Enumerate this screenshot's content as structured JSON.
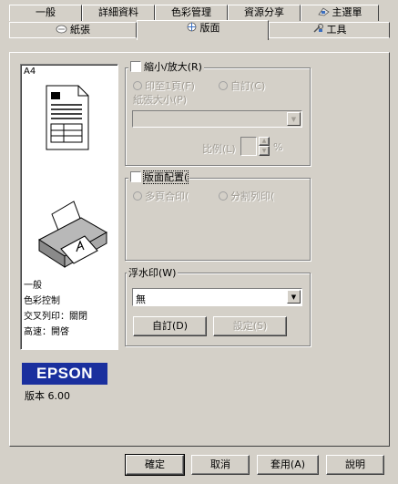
{
  "tabs_row1": [
    {
      "label": "一般"
    },
    {
      "label": "詳細資料"
    },
    {
      "label": "色彩管理"
    },
    {
      "label": "資源分享"
    },
    {
      "label": "主選單"
    }
  ],
  "tabs_row2": [
    {
      "label": "紙張"
    },
    {
      "label": "版面"
    },
    {
      "label": "工具"
    }
  ],
  "preview": {
    "paper_size": "A4",
    "info_lines": [
      "一般",
      "色彩控制",
      "交叉列印：關閉",
      "高速：開啓"
    ]
  },
  "reduce_enlarge": {
    "title": "縮小/放大(R)",
    "fit_page": "印至1頁(F)",
    "custom": "自訂(C)",
    "paper_size_label": "紙張大小(P)",
    "ratio_label": "比例(L)",
    "percent": "%"
  },
  "multi_page": {
    "title": "版面配置(",
    "n_up": "多頁合印(",
    "poster": "分割列印("
  },
  "watermark": {
    "title": "浮水印(W)",
    "selected": "無",
    "custom_button": "自訂(D)",
    "settings_button": "設定(S)"
  },
  "brand": {
    "logo": "EPSON",
    "version": "版本 6.00",
    "color": "#1a2f9e"
  },
  "footer": {
    "ok": "確定",
    "cancel": "取消",
    "apply": "套用(A)",
    "help": "說明"
  }
}
